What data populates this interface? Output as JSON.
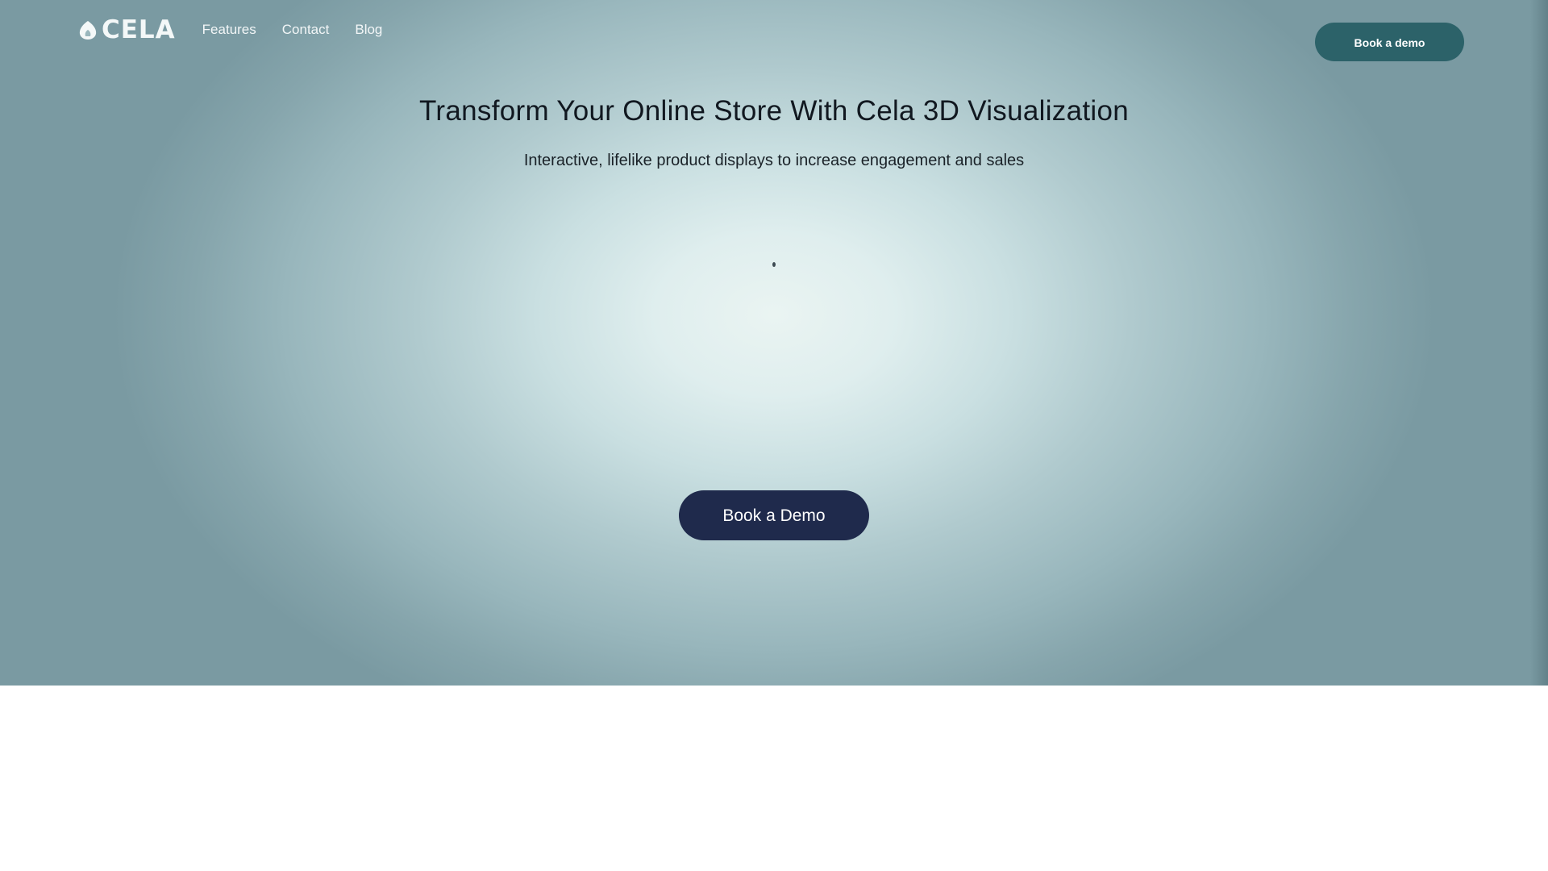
{
  "brand": {
    "logo_text": "CELA",
    "icon": "cela-logo-icon"
  },
  "nav": {
    "items": [
      {
        "label": "Features"
      },
      {
        "label": "Contact"
      },
      {
        "label": "Blog"
      }
    ],
    "cta_label": "Book a demo"
  },
  "hero": {
    "title": "Transform Your Online Store With Cela 3D Visualization",
    "subtitle": "Interactive, lifelike product displays to increase engagement and sales",
    "cta_label": "Book a Demo",
    "loading_icon": "loading-dot-icon"
  },
  "colors": {
    "hero_center": "#eaf4f2",
    "hero_edge": "#7a9aa2",
    "nav_button": "#2c6269",
    "hero_button": "#1f2a4c",
    "text_dark": "#111820",
    "page_background": "#ffffff"
  }
}
